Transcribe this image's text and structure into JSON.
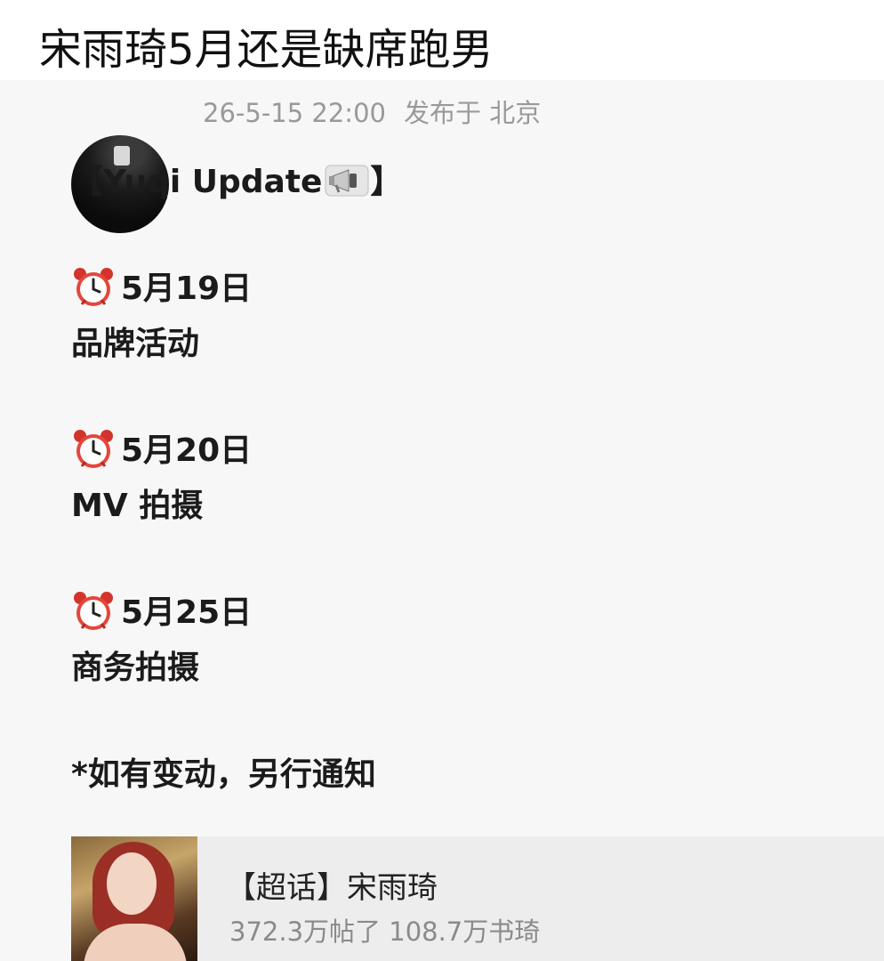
{
  "headline": "宋雨琦5月还是缺席跑男",
  "post": {
    "timestamp": "26-5-15 22:00",
    "location": "发布于 北京",
    "header_text": "【Yuqi Update",
    "header_close": "】",
    "schedule": [
      {
        "date": "5月19日",
        "event": "品牌活动"
      },
      {
        "date": "5月20日",
        "event": "MV 拍摄"
      },
      {
        "date": "5月25日",
        "event": "商务拍摄"
      }
    ],
    "note": "*如有变动，另行通知"
  },
  "supertopic": {
    "title": "【超话】宋雨琦",
    "stats": "372.3万帖了 108.7万书琦"
  }
}
